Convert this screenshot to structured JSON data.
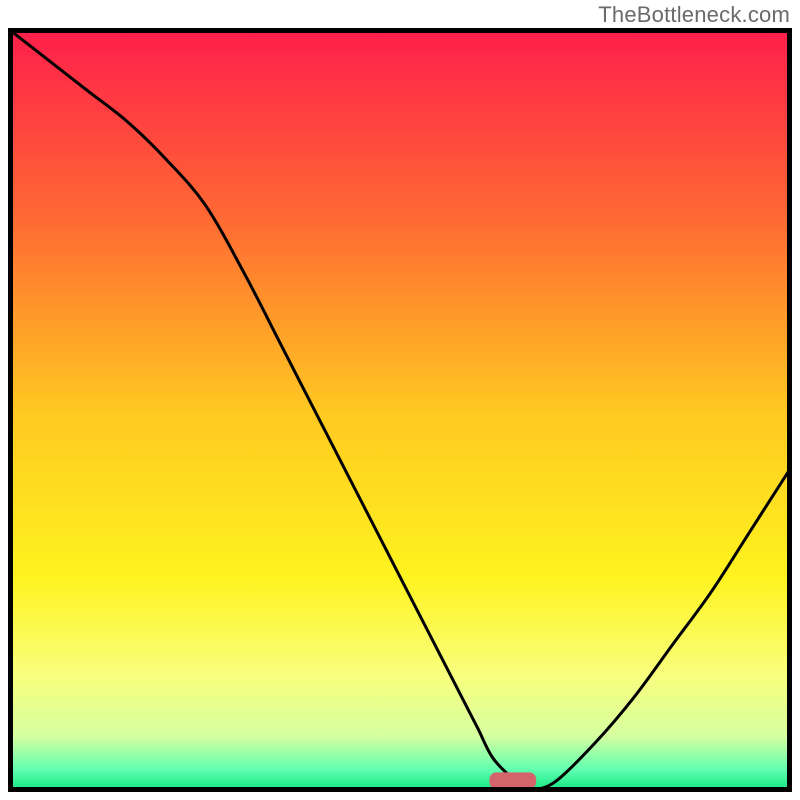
{
  "branding": {
    "watermark": "TheBottleneck.com"
  },
  "chart_data": {
    "type": "line",
    "title": "",
    "xlabel": "",
    "ylabel": "",
    "xlim": [
      0,
      100
    ],
    "ylim": [
      0,
      100
    ],
    "grid": false,
    "legend": false,
    "background_gradient": {
      "stops": [
        {
          "pos": 0.0,
          "color": "#ff1f4b"
        },
        {
          "pos": 0.25,
          "color": "#ff6a33"
        },
        {
          "pos": 0.5,
          "color": "#ffc821"
        },
        {
          "pos": 0.72,
          "color": "#fff31f"
        },
        {
          "pos": 0.85,
          "color": "#f8ff7d"
        },
        {
          "pos": 0.93,
          "color": "#d6ffa0"
        },
        {
          "pos": 0.975,
          "color": "#5fffb0"
        },
        {
          "pos": 1.0,
          "color": "#17e884"
        }
      ]
    },
    "series": [
      {
        "name": "bottleneck-curve",
        "stroke": "#000000",
        "x": [
          0,
          5,
          10,
          15,
          20,
          25,
          30,
          35,
          40,
          45,
          50,
          55,
          58,
          60,
          62,
          65,
          67,
          70,
          75,
          80,
          85,
          90,
          95,
          100
        ],
        "y": [
          100,
          96,
          92,
          88,
          83,
          77,
          68,
          58,
          48,
          38,
          28,
          18,
          12,
          8,
          4,
          1,
          0,
          1,
          6,
          12,
          19,
          26,
          34,
          42
        ]
      }
    ],
    "marker": {
      "name": "optimal-zone-marker",
      "shape": "rounded-rect",
      "color": "#d4646c",
      "x_center": 64.5,
      "width": 6,
      "y": 0,
      "height": 2.2
    },
    "frame": {
      "stroke": "#000000",
      "width": 5
    }
  }
}
